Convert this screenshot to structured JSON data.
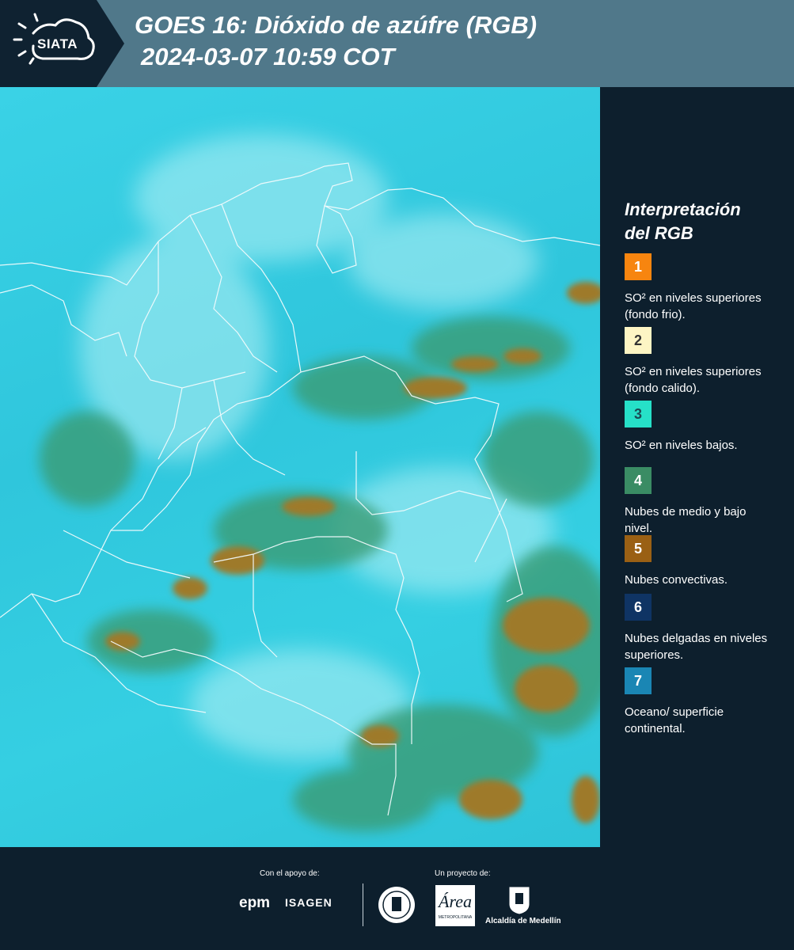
{
  "header": {
    "logo_text": "SIATA",
    "title_line1": "GOES 16: Dióxido de azúfre (RGB)",
    "title_line2": "2024-03-07 10:59 COT"
  },
  "legend": {
    "title_line1": "Interpretación",
    "title_line2": "del RGB",
    "items": [
      {
        "num": "1",
        "color": "#f7850f",
        "text_color": "#ffffff",
        "text": "SO² en niveles superiores (fondo frio)."
      },
      {
        "num": "2",
        "color": "#fdf5c4",
        "text_color": "#333333",
        "text": "SO² en niveles superiores (fondo calido)."
      },
      {
        "num": "3",
        "color": "#26e0c8",
        "text_color": "#1b4a55",
        "text": "SO² en niveles bajos."
      },
      {
        "num": "4",
        "color": "#3a8c64",
        "text_color": "#ffffff",
        "text": "Nubes de medio y bajo nivel."
      },
      {
        "num": "5",
        "color": "#9a6014",
        "text_color": "#ffffff",
        "text": "Nubes convectivas."
      },
      {
        "num": "6",
        "color": "#0f3464",
        "text_color": "#ffffff",
        "text": "Nubes delgadas en niveles superiores."
      },
      {
        "num": "7",
        "color": "#1a86b4",
        "text_color": "#ffffff",
        "text": "Oceano/ superficie continental."
      }
    ]
  },
  "footer": {
    "support_label": "Con el apoyo de:",
    "project_label": "Un proyecto de:",
    "sponsor_1": "epm",
    "sponsor_2": "ISAGEN",
    "partner_2": "Área Metropolitana Valle de Aburrá",
    "partner_3": "Alcaldía de Medellín"
  }
}
